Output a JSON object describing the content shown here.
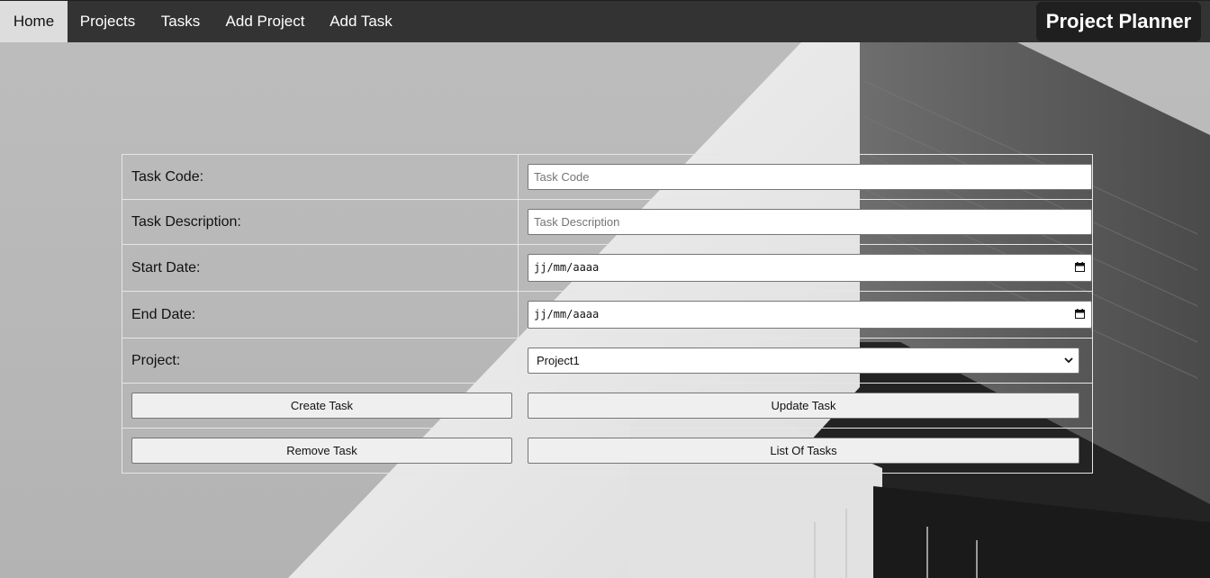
{
  "nav": {
    "items": [
      {
        "label": "Home",
        "active": true
      },
      {
        "label": "Projects",
        "active": false
      },
      {
        "label": "Tasks",
        "active": false
      },
      {
        "label": "Add Project",
        "active": false
      },
      {
        "label": "Add Task",
        "active": false
      }
    ],
    "brand": "Project Planner"
  },
  "form": {
    "task_code": {
      "label": "Task Code:",
      "placeholder": "Task Code",
      "value": ""
    },
    "task_description": {
      "label": "Task Description:",
      "placeholder": "Task Description",
      "value": ""
    },
    "start_date": {
      "label": "Start Date:",
      "value": "jj/mm/aaaa"
    },
    "end_date": {
      "label": "End Date:",
      "value": "jj/mm/aaaa"
    },
    "project": {
      "label": "Project:",
      "selected": "Project1"
    },
    "buttons": {
      "create": "Create Task",
      "update": "Update Task",
      "remove": "Remove Task",
      "list": "List Of Tasks"
    }
  },
  "colors": {
    "nav_bg": "#333333",
    "nav_active_bg": "#dddddd",
    "brand_bg": "#1f1f1f",
    "button_bg": "#efefef"
  }
}
